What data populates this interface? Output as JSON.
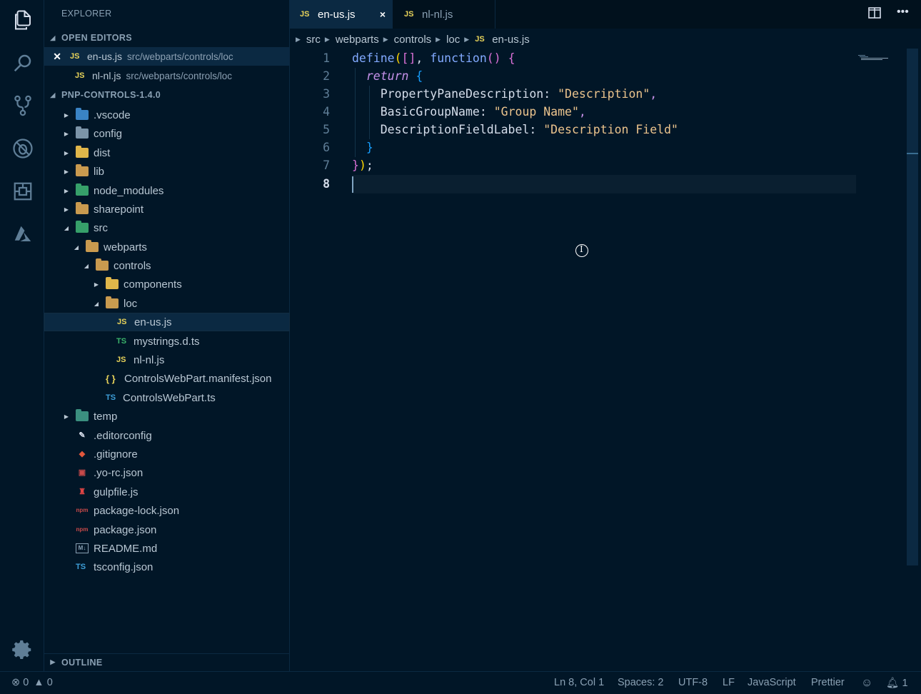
{
  "activity_bar": {
    "icons": [
      "files-icon",
      "search-icon",
      "source-control-icon",
      "debug-icon",
      "extensions-icon",
      "azure-icon",
      "settings-gear-icon"
    ]
  },
  "sidebar": {
    "title": "EXPLORER",
    "open_editors": {
      "heading": "OPEN EDITORS",
      "items": [
        {
          "badge": "JS",
          "name": "en-us.js",
          "path": "src/webparts/controls/loc",
          "active": true
        },
        {
          "badge": "JS",
          "name": "nl-nl.js",
          "path": "src/webparts/controls/loc",
          "active": false
        }
      ]
    },
    "project": {
      "heading": "PNP-CONTROLS-1.4.0",
      "tree": [
        {
          "label": ".vscode"
        },
        {
          "label": "config"
        },
        {
          "label": "dist"
        },
        {
          "label": "lib"
        },
        {
          "label": "node_modules"
        },
        {
          "label": "sharepoint"
        },
        {
          "label": "src"
        },
        {
          "label": "webparts"
        },
        {
          "label": "controls"
        },
        {
          "label": "components"
        },
        {
          "label": "loc"
        },
        {
          "label": "en-us.js",
          "badge": "JS"
        },
        {
          "label": "mystrings.d.ts",
          "badge": "TS"
        },
        {
          "label": "nl-nl.js",
          "badge": "JS"
        },
        {
          "label": "ControlsWebPart.manifest.json",
          "badge": "{ }"
        },
        {
          "label": "ControlsWebPart.ts",
          "badge": "TS"
        },
        {
          "label": "temp"
        },
        {
          "label": ".editorconfig"
        },
        {
          "label": ".gitignore"
        },
        {
          "label": ".yo-rc.json"
        },
        {
          "label": "gulpfile.js"
        },
        {
          "label": "package-lock.json"
        },
        {
          "label": "package.json"
        },
        {
          "label": "README.md"
        },
        {
          "label": "tsconfig.json",
          "badge": "TS"
        }
      ]
    },
    "outline_heading": "OUTLINE"
  },
  "tabs": [
    {
      "badge": "JS",
      "label": "en-us.js",
      "active": true,
      "close": "×"
    },
    {
      "badge": "JS",
      "label": "nl-nl.js",
      "active": false
    }
  ],
  "top_actions": {
    "split": "split-editor-icon",
    "more": "•••"
  },
  "breadcrumb": [
    "src",
    "webparts",
    "controls",
    "loc",
    "en-us.js"
  ],
  "breadcrumb_file_badge": "JS",
  "editor": {
    "line_numbers": [
      "1",
      "2",
      "3",
      "4",
      "5",
      "6",
      "7",
      "8"
    ],
    "current_line": "8"
  },
  "status_bar": {
    "errors": "0",
    "warnings": "0",
    "position": "Ln 8, Col 1",
    "spaces": "Spaces: 2",
    "encoding": "UTF-8",
    "eol": "LF",
    "language": "JavaScript",
    "formatter": "Prettier",
    "notifications": "1"
  },
  "colors": {
    "background": "#011627",
    "function": "#82aaff",
    "keyword": "#c792ea",
    "string": "#ecc48d",
    "js_badge": "#e8d35a",
    "ts_badge": "#3e9fd9"
  }
}
